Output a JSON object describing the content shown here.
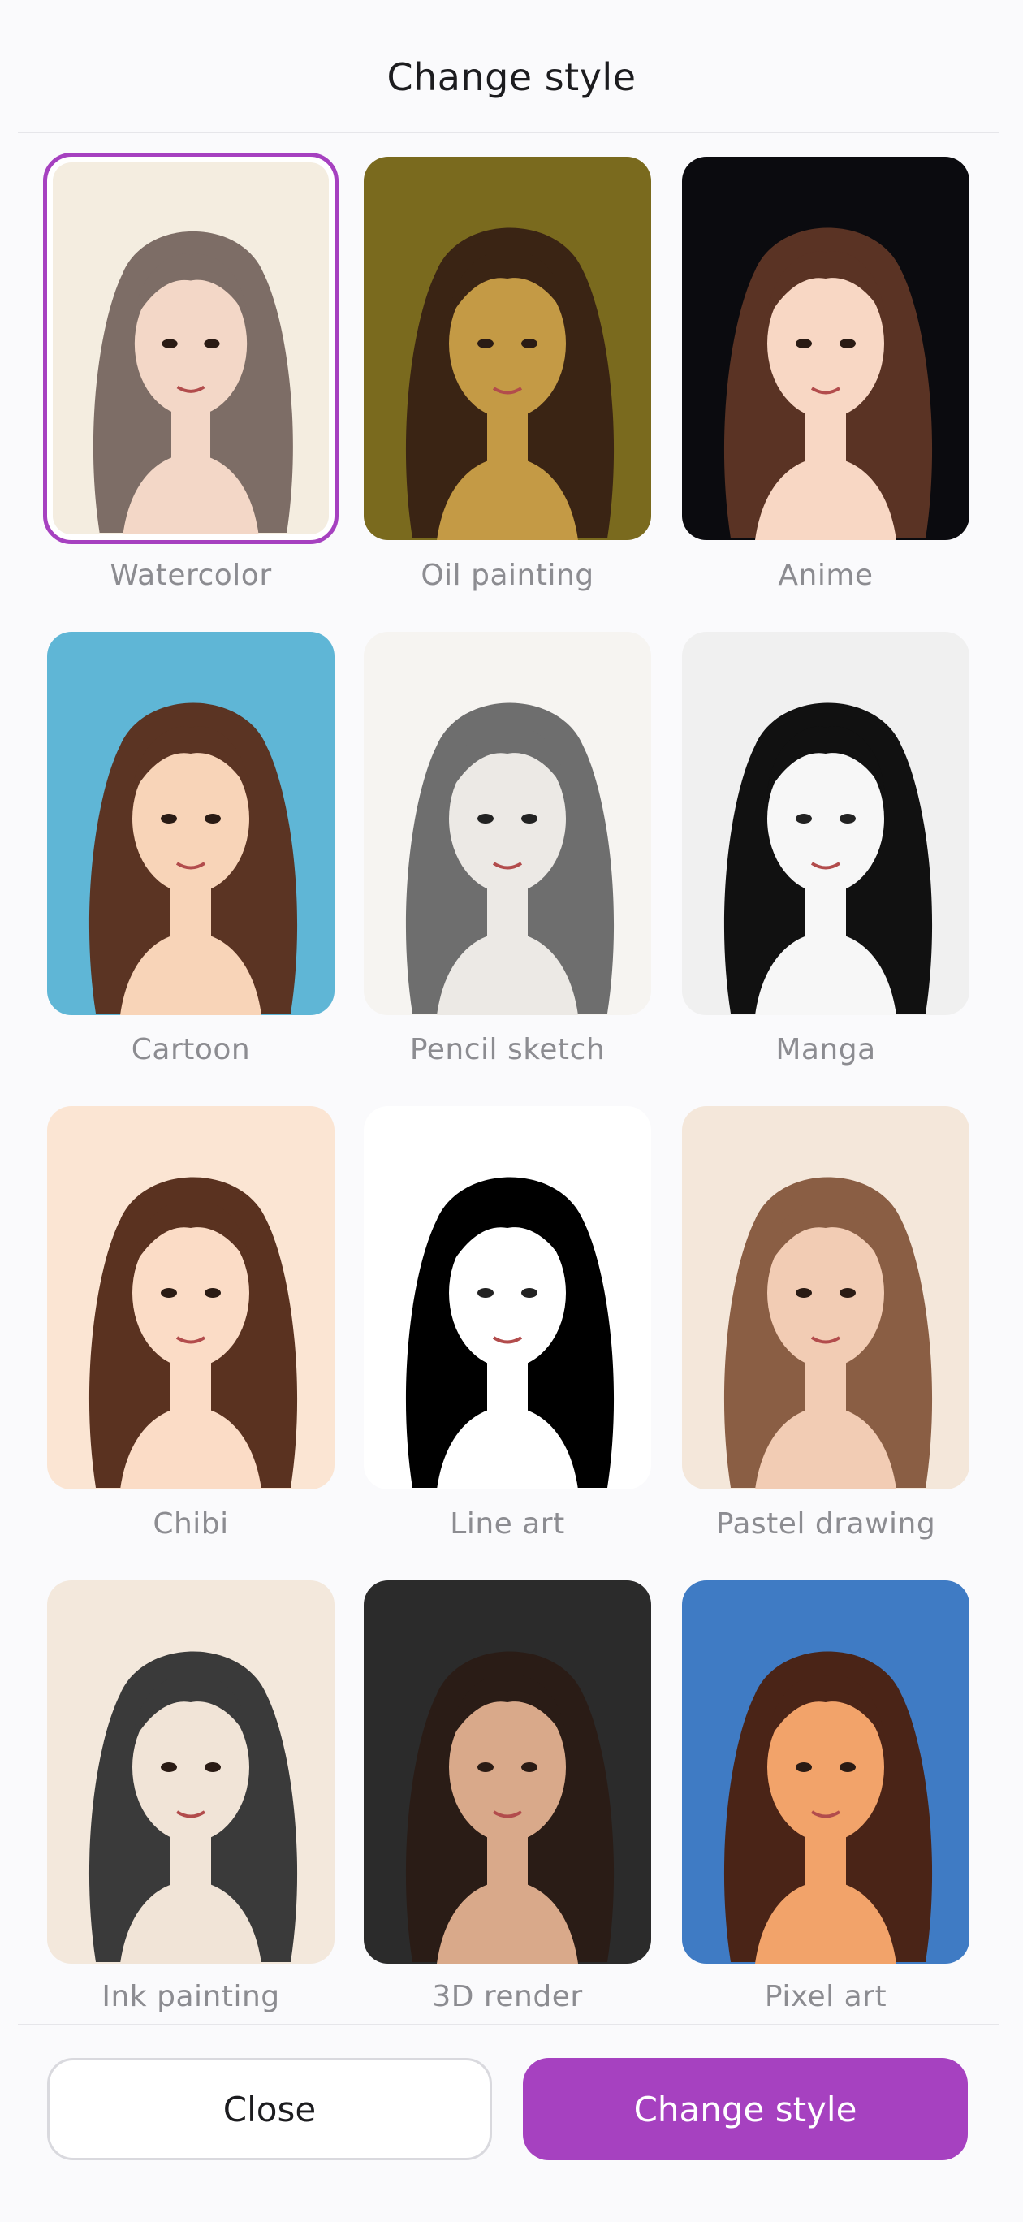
{
  "header": {
    "title": "Change style"
  },
  "styles": [
    {
      "label": "Watercolor",
      "selected": true,
      "icon": "watercolor-portrait",
      "bg": "#f4ede0",
      "hair": "#7d6d66",
      "skin": "#f3d7c7"
    },
    {
      "label": "Oil painting",
      "selected": false,
      "icon": "oil-painting-portrait",
      "bg": "#7a6a1e",
      "hair": "#3a2414",
      "skin": "#c49a45"
    },
    {
      "label": "Anime",
      "selected": false,
      "icon": "anime-portrait",
      "bg": "#0b0b0f",
      "hair": "#5a3324",
      "skin": "#f8d7c4"
    },
    {
      "label": "Cartoon",
      "selected": false,
      "icon": "cartoon-portrait",
      "bg": "#5fb6d6",
      "hair": "#5b3423",
      "skin": "#f8d4b8"
    },
    {
      "label": "Pencil sketch",
      "selected": false,
      "icon": "pencil-sketch-portrait",
      "bg": "#f6f4f1",
      "hair": "#6e6e6e",
      "skin": "#ece9e5"
    },
    {
      "label": "Manga",
      "selected": false,
      "icon": "manga-portrait",
      "bg": "#f0f0f0",
      "hair": "#111111",
      "skin": "#f7f7f7"
    },
    {
      "label": "Chibi",
      "selected": false,
      "icon": "chibi-portrait",
      "bg": "#fbe5d3",
      "hair": "#5a3220",
      "skin": "#fbdcc6"
    },
    {
      "label": "Line art",
      "selected": false,
      "icon": "line-art-portrait",
      "bg": "#ffffff",
      "hair": "#000000",
      "skin": "#ffffff"
    },
    {
      "label": "Pastel drawing",
      "selected": false,
      "icon": "pastel-drawing-portrait",
      "bg": "#f4e7da",
      "hair": "#8a5e44",
      "skin": "#f2ccb4"
    },
    {
      "label": "Ink painting",
      "selected": false,
      "icon": "ink-painting-portrait",
      "bg": "#f3e8dc",
      "hair": "#3a3a3a",
      "skin": "#f1e4d7"
    },
    {
      "label": "3D render",
      "selected": false,
      "icon": "3d-render-portrait",
      "bg": "#2b2b2b",
      "hair": "#2a1c16",
      "skin": "#d9a98a"
    },
    {
      "label": "Pixel art",
      "selected": false,
      "icon": "pixel-art-portrait",
      "bg": "#3f7bc4",
      "hair": "#4a2417",
      "skin": "#f2a36a"
    }
  ],
  "footer": {
    "close_label": "Close",
    "primary_label": "Change style"
  },
  "colors": {
    "accent": "#a641c0",
    "muted_text": "#8c8c91"
  }
}
